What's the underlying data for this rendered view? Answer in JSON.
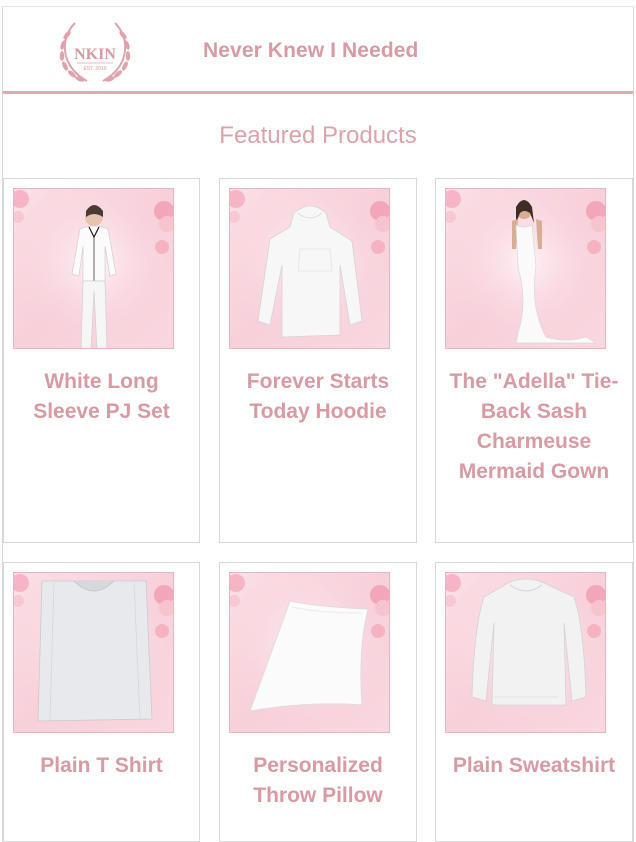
{
  "brand": {
    "logo_text": "NKIN",
    "logo_sub": "EST. 2019",
    "name": "Never Knew I Needed"
  },
  "section_title": "Featured Products",
  "products": [
    {
      "title": "White Long Sleeve PJ Set",
      "image": "pajama-set-image"
    },
    {
      "title": "Forever Starts Today Hoodie",
      "image": "hoodie-image"
    },
    {
      "title": "The \"Adella\" Tie-Back Sash Charmeuse Mermaid Gown",
      "image": "gown-image"
    },
    {
      "title": "Plain T Shirt",
      "image": "tshirt-image"
    },
    {
      "title": "Personalized Throw Pillow",
      "image": "pillow-image"
    },
    {
      "title": "Plain Sweatshirt",
      "image": "sweatshirt-image"
    }
  ],
  "colors": {
    "accent": "#d99aa3",
    "rule": "#e2a9b0",
    "thumb_bg": "#f9d4dc"
  }
}
